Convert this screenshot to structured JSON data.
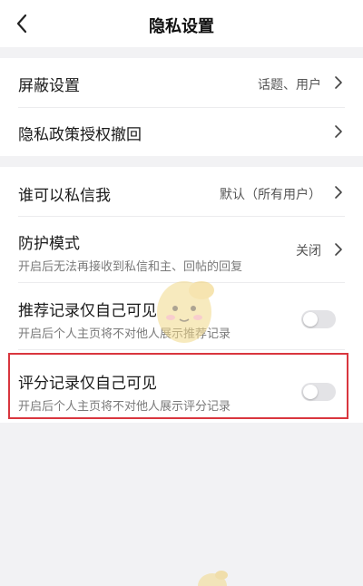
{
  "header": {
    "title": "隐私设置"
  },
  "rows": {
    "block": {
      "title": "屏蔽设置",
      "value": "话题、用户"
    },
    "privacy_policy": {
      "title": "隐私政策授权撤回"
    },
    "who_can_message": {
      "title": "谁可以私信我",
      "value": "默认（所有用户）"
    },
    "protection_mode": {
      "title": "防护模式",
      "desc": "开启后无法再接收到私信和主、回帖的回复",
      "value": "关闭"
    },
    "recommend_private": {
      "title": "推荐记录仅自己可见",
      "desc": "开启后个人主页将不对他人展示推荐记录",
      "enabled": false
    },
    "rating_private": {
      "title": "评分记录仅自己可见",
      "desc": "开启后个人主页将不对他人展示评分记录",
      "enabled": false
    }
  },
  "colors": {
    "background": "#f2f2f4",
    "card": "#ffffff",
    "highlight": "#d9363e",
    "toggle_off": "#e3e3e6"
  },
  "icons": {
    "back": "chevron-left-icon",
    "row_arrow": "chevron-right-icon",
    "watermark": "mascot-watermark"
  }
}
